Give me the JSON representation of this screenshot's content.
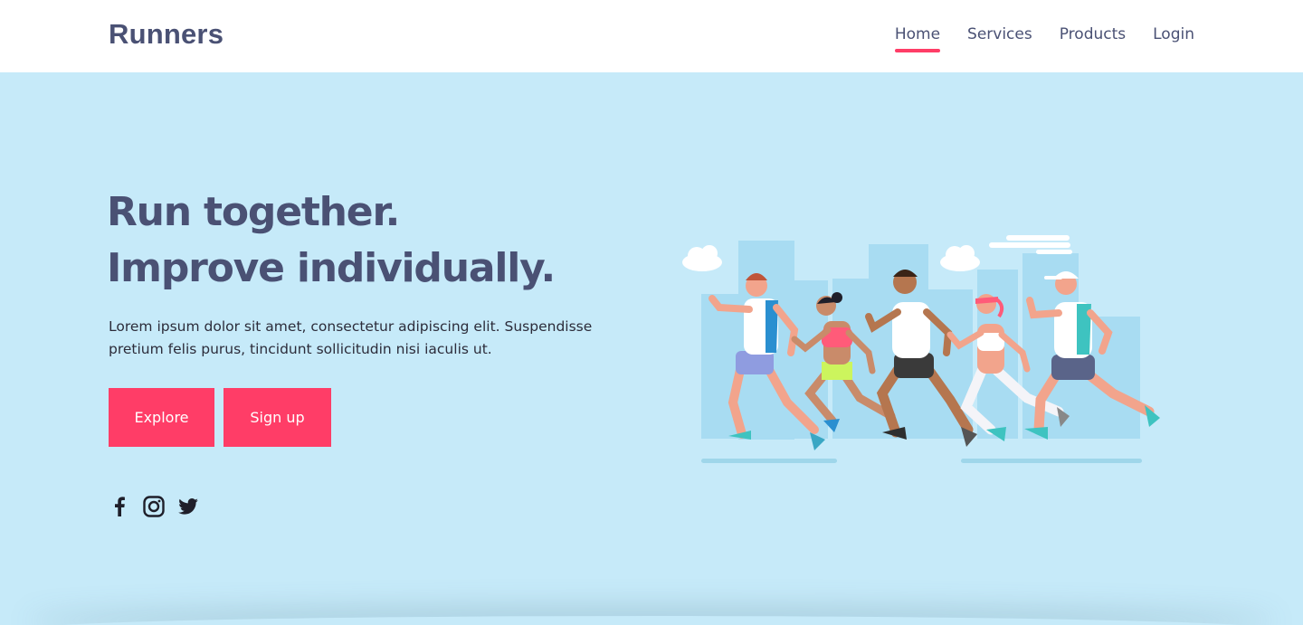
{
  "brand": "Runners",
  "nav": {
    "items": [
      {
        "label": "Home",
        "active": true
      },
      {
        "label": "Services",
        "active": false
      },
      {
        "label": "Products",
        "active": false
      },
      {
        "label": "Login",
        "active": false
      }
    ]
  },
  "hero": {
    "headline_line1": "Run together.",
    "headline_line2": "Improve individually.",
    "lead": "Lorem ipsum dolor sit amet, consectetur adipiscing elit. Suspendisse pretium felis purus, tincidunt sollicitudin nisi iaculis ut.",
    "buttons": {
      "explore": "Explore",
      "signup": "Sign up"
    }
  },
  "socials": [
    "facebook-icon",
    "instagram-icon",
    "twitter-icon"
  ],
  "colors": {
    "accent": "#ff3d67",
    "hero_bg": "#c6eaf9",
    "text": "#4a5174"
  }
}
